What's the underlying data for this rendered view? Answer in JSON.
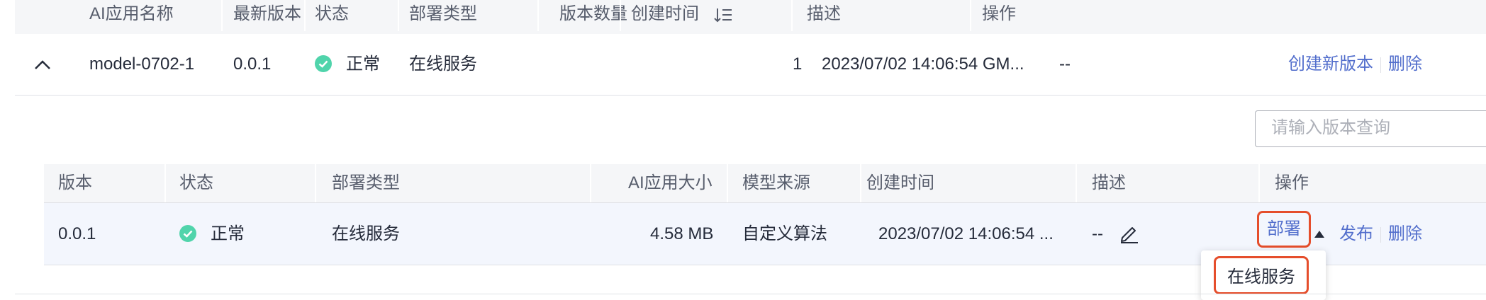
{
  "main_table": {
    "columns": [
      "AI应用名称",
      "最新版本",
      "状态",
      "部署类型",
      "版本数量",
      "创建时间",
      "描述",
      "操作"
    ],
    "row": {
      "name": "model-0702-1",
      "latest_version": "0.0.1",
      "status": "正常",
      "deploy_type": "在线服务",
      "version_count": "1",
      "created": "2023/07/02 14:06:54 GM...",
      "description": "--",
      "actions": [
        "创建新版本",
        "删除"
      ]
    }
  },
  "version_search": {
    "placeholder": "请输入版本查询"
  },
  "version_table": {
    "columns": [
      "版本",
      "状态",
      "部署类型",
      "AI应用大小",
      "模型来源",
      "创建时间",
      "描述",
      "操作"
    ],
    "row": {
      "version": "0.0.1",
      "status": "正常",
      "deploy_type": "在线服务",
      "size": "4.58 MB",
      "source": "自定义算法",
      "created": "2023/07/02 14:06:54 ...",
      "description": "--",
      "actions": {
        "deploy": "部署",
        "publish": "发布",
        "delete": "删除"
      }
    }
  },
  "deploy_dropdown": {
    "items": [
      "在线服务"
    ]
  },
  "colors": {
    "link": "#526ecc",
    "status_ok": "#50d4ab",
    "highlight": "#e54e2c",
    "header_bg": "#f5f6f8",
    "row_hover_bg": "#f3f6fd"
  },
  "icons": {
    "sort": "sort-desc-icon",
    "collapse": "chevron-up-icon",
    "status": "check-circle-icon",
    "edit": "pencil-icon",
    "dropdown_caret": "caret-up-icon"
  }
}
